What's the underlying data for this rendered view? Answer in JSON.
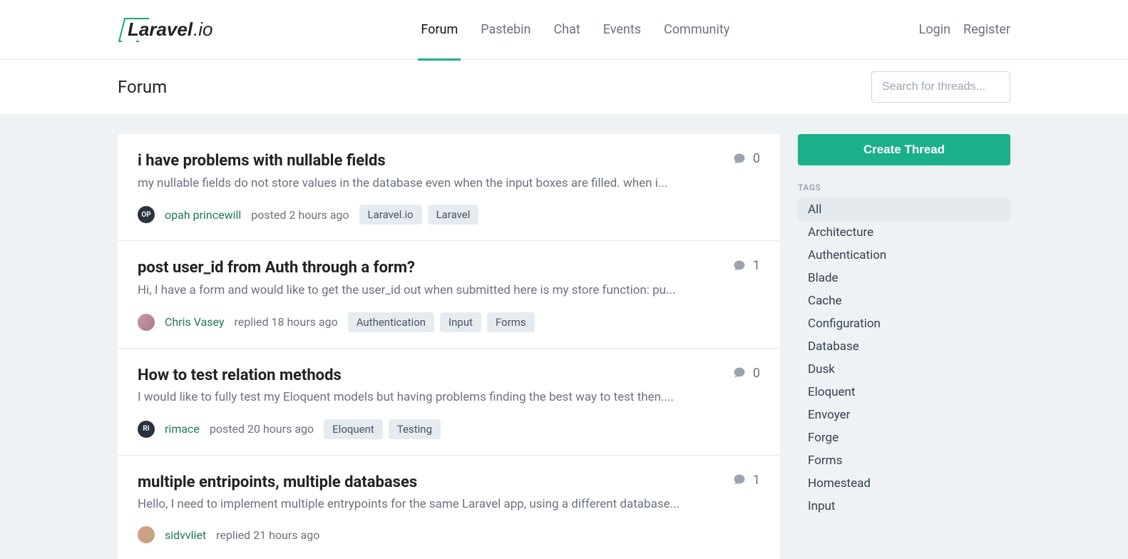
{
  "brand": {
    "name": "Laravel",
    "suffix": ".io"
  },
  "nav": {
    "items": [
      {
        "label": "Forum",
        "active": true
      },
      {
        "label": "Pastebin",
        "active": false
      },
      {
        "label": "Chat",
        "active": false
      },
      {
        "label": "Events",
        "active": false
      },
      {
        "label": "Community",
        "active": false
      }
    ]
  },
  "auth": {
    "login": "Login",
    "register": "Register"
  },
  "page": {
    "title": "Forum"
  },
  "search": {
    "placeholder": "Search for threads..."
  },
  "threads": [
    {
      "title": "i have problems with nullable fields",
      "excerpt": "my nullable fields do not store values in the database even when the input boxes are filled. when i...",
      "avatar_text": "OP",
      "avatar_class": "",
      "author": "opah princewill",
      "action": "posted",
      "time": "2 hours ago",
      "tags": [
        "Laravel.io",
        "Laravel"
      ],
      "replies": "0"
    },
    {
      "title": "post user_id from Auth through a form?",
      "excerpt": "Hi, I have a form and would like to get the user_id out when submitted here is my store function: pu...",
      "avatar_text": "",
      "avatar_class": "img1",
      "author": "Chris Vasey",
      "action": "replied",
      "time": "18 hours ago",
      "tags": [
        "Authentication",
        "Input",
        "Forms"
      ],
      "replies": "1"
    },
    {
      "title": "How to test relation methods",
      "excerpt": "I would like to fully test my Eloquent models but having problems finding the best way to test then....",
      "avatar_text": "RI",
      "avatar_class": "",
      "author": "rimace",
      "action": "posted",
      "time": "20 hours ago",
      "tags": [
        "Eloquent",
        "Testing"
      ],
      "replies": "0"
    },
    {
      "title": "multiple entripoints, multiple databases",
      "excerpt": "Hello, I need to implement multiple entrypoints for the same Laravel app, using a different database...",
      "avatar_text": "",
      "avatar_class": "img2",
      "author": "sidvvliet",
      "action": "replied",
      "time": "21 hours ago",
      "tags": [],
      "replies": "1"
    }
  ],
  "sidebar": {
    "create_label": "Create Thread",
    "tags_label": "TAGS",
    "tags": [
      {
        "label": "All",
        "active": true
      },
      {
        "label": "Architecture",
        "active": false
      },
      {
        "label": "Authentication",
        "active": false
      },
      {
        "label": "Blade",
        "active": false
      },
      {
        "label": "Cache",
        "active": false
      },
      {
        "label": "Configuration",
        "active": false
      },
      {
        "label": "Database",
        "active": false
      },
      {
        "label": "Dusk",
        "active": false
      },
      {
        "label": "Eloquent",
        "active": false
      },
      {
        "label": "Envoyer",
        "active": false
      },
      {
        "label": "Forge",
        "active": false
      },
      {
        "label": "Forms",
        "active": false
      },
      {
        "label": "Homestead",
        "active": false
      },
      {
        "label": "Input",
        "active": false
      }
    ]
  }
}
